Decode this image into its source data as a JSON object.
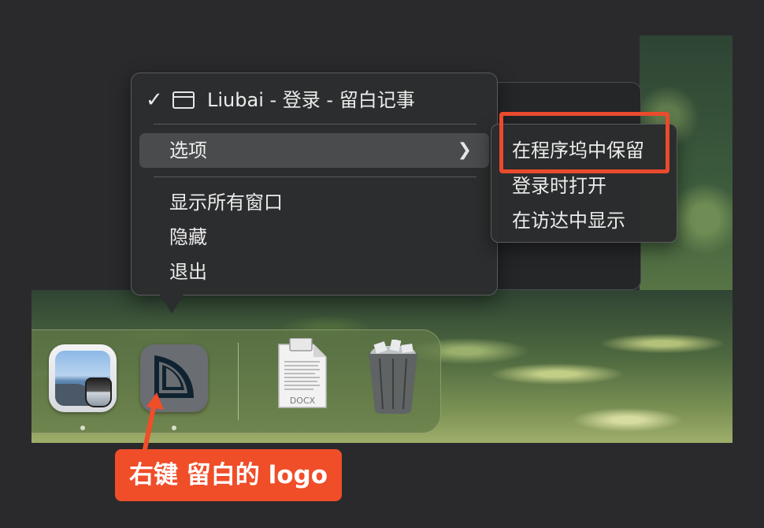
{
  "context_menu": {
    "window_item": {
      "checked": true,
      "label": "Liubai - 登录 - 留白记事",
      "icon": "window-icon"
    },
    "options_item": {
      "label": "选项",
      "submenu_indicator": "chevron-right-icon"
    },
    "items": [
      {
        "label": "显示所有窗口"
      },
      {
        "label": "隐藏"
      },
      {
        "label": "退出"
      }
    ]
  },
  "options_submenu": {
    "items": [
      {
        "label": "在程序坞中保留",
        "highlighted": true
      },
      {
        "label": "登录时打开"
      },
      {
        "label": "在访达中显示"
      }
    ]
  },
  "dock": {
    "apps": [
      {
        "name": "preview-app-icon",
        "running": true
      },
      {
        "name": "liubai-app-icon",
        "running": true
      },
      {
        "name": "docx-document-icon",
        "label": "DOCX",
        "running": false
      },
      {
        "name": "trash-icon",
        "running": false
      }
    ]
  },
  "annotation": {
    "callout_text": "右键 留白的 logo",
    "highlight_color": "#ea4a2d",
    "callout_color": "#f04d29"
  }
}
